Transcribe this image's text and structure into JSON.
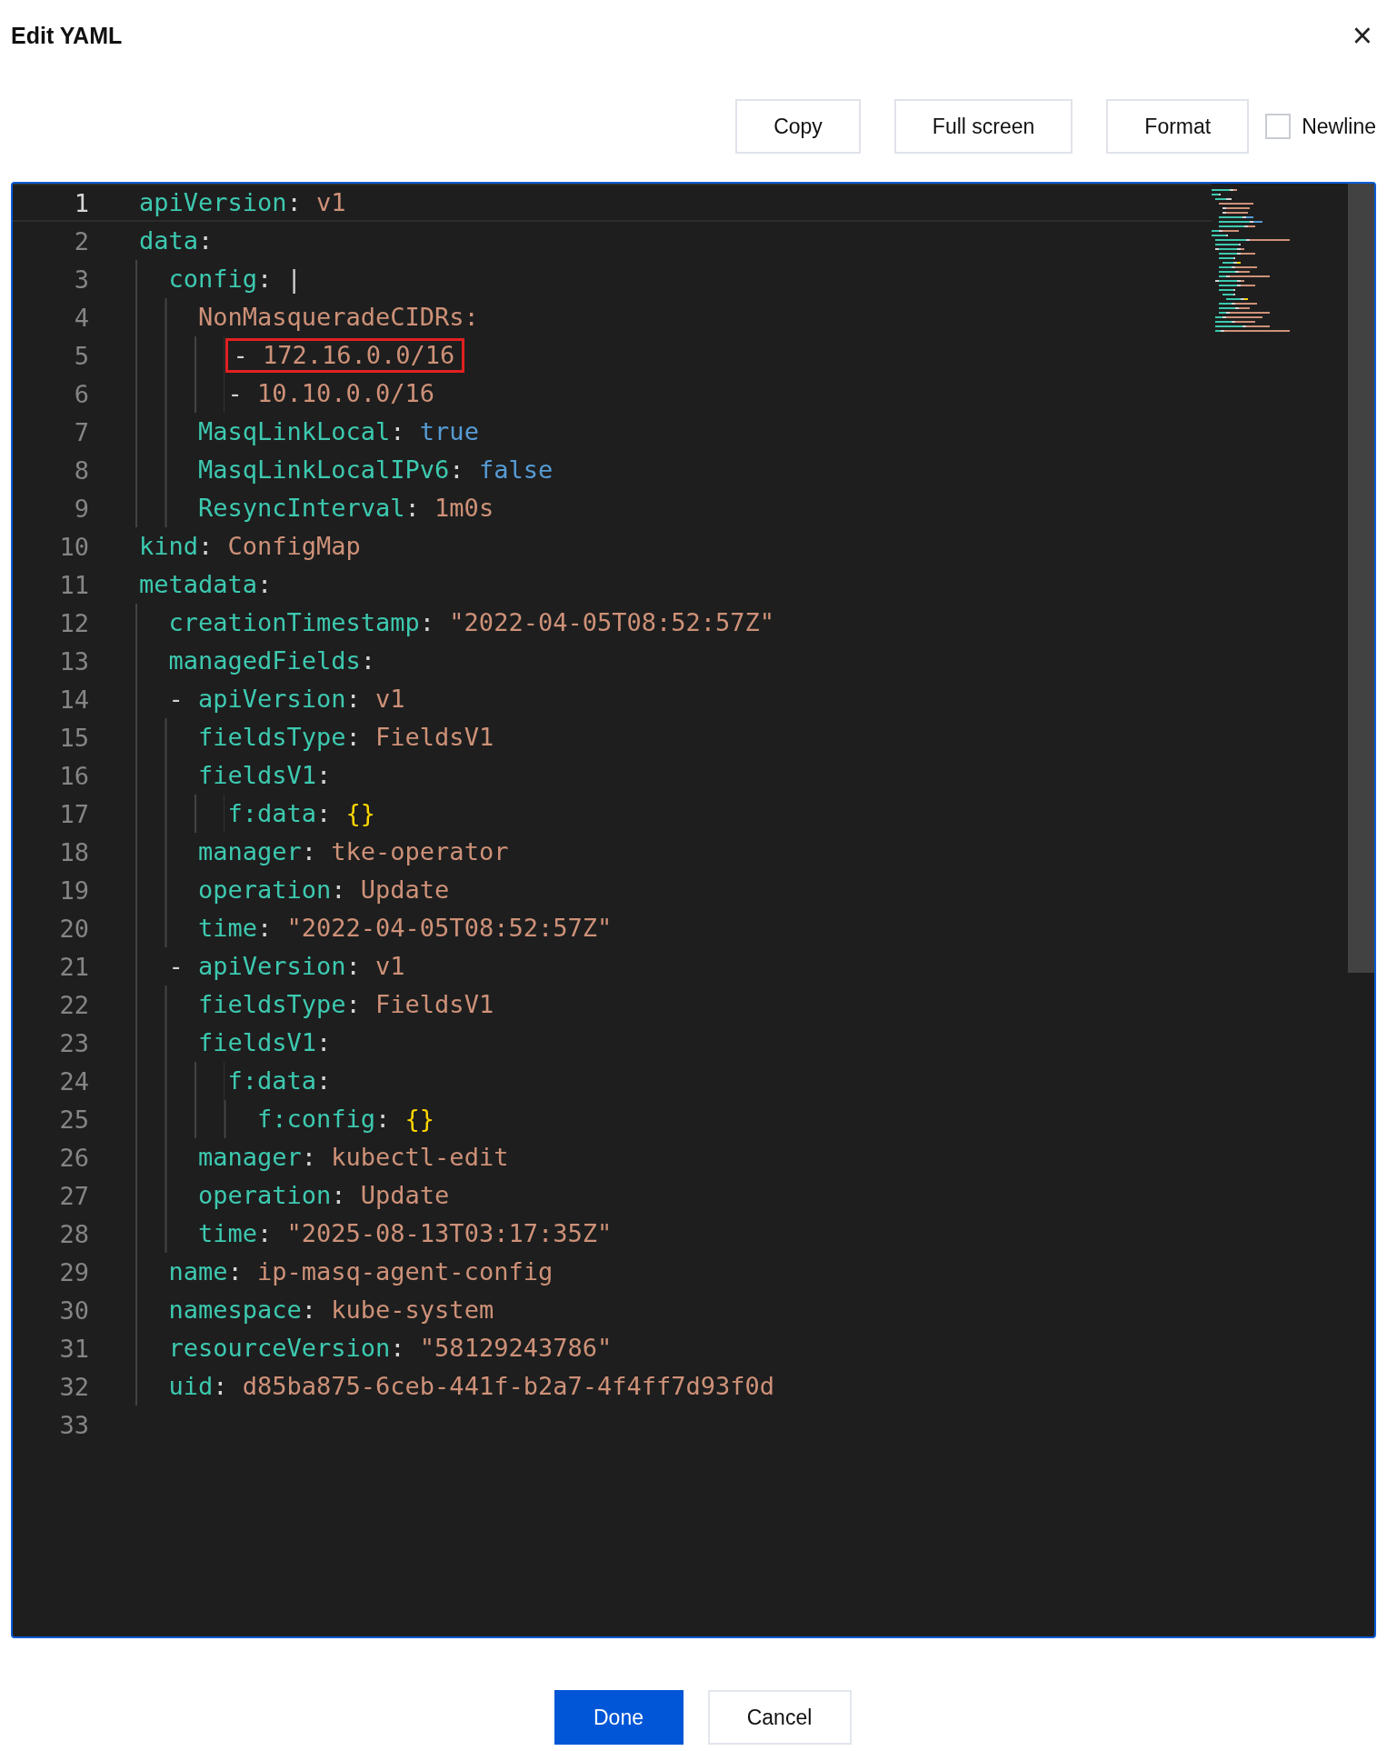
{
  "dialog": {
    "title": "Edit YAML",
    "close": "×"
  },
  "toolbar": {
    "buttons": [
      "Copy",
      "Full screen",
      "Format"
    ],
    "newline": {
      "label": "Newline",
      "checked": false
    }
  },
  "editor": {
    "lines": [
      {
        "number": "1",
        "current": true,
        "boxed": false,
        "tokens": [
          {
            "kind": "key",
            "text": "apiVersion"
          },
          {
            "kind": "punct",
            "text": ": "
          },
          {
            "kind": "value",
            "text": "v1"
          }
        ]
      },
      {
        "number": "2",
        "current": false,
        "boxed": false,
        "tokens": [
          {
            "kind": "key",
            "text": "data"
          },
          {
            "kind": "punct",
            "text": ":"
          }
        ],
        "children": [
          {
            "number": "3",
            "current": false,
            "boxed": false,
            "tokens": [
              {
                "kind": "key",
                "text": "config"
              },
              {
                "kind": "punct",
                "text": ": |"
              }
            ],
            "children": [
              {
                "number": "4",
                "current": false,
                "boxed": false,
                "tokens": [
                  {
                    "kind": "value",
                    "text": "NonMasqueradeCIDRs:"
                  }
                ],
                "children": [
                  {
                    "number": "5",
                    "current": false,
                    "boxed": true,
                    "tokens": [
                      {
                        "kind": "punct",
                        "text": "- "
                      },
                      {
                        "kind": "value",
                        "text": "172.16.0.0/16"
                      }
                    ]
                  },
                  {
                    "number": "6",
                    "current": false,
                    "boxed": false,
                    "tokens": [
                      {
                        "kind": "punct",
                        "text": "- "
                      },
                      {
                        "kind": "value",
                        "text": "10.10.0.0/16"
                      }
                    ]
                  }
                ]
              },
              {
                "number": "7",
                "current": false,
                "boxed": false,
                "tokens": [
                  {
                    "kind": "key",
                    "text": "MasqLinkLocal"
                  },
                  {
                    "kind": "punct",
                    "text": ": "
                  },
                  {
                    "kind": "bool",
                    "text": "true"
                  }
                ]
              },
              {
                "number": "8",
                "current": false,
                "boxed": false,
                "tokens": [
                  {
                    "kind": "key",
                    "text": "MasqLinkLocalIPv6"
                  },
                  {
                    "kind": "punct",
                    "text": ": "
                  },
                  {
                    "kind": "bool",
                    "text": "false"
                  }
                ]
              },
              {
                "number": "9",
                "current": false,
                "boxed": false,
                "tokens": [
                  {
                    "kind": "key",
                    "text": "ResyncInterval"
                  },
                  {
                    "kind": "punct",
                    "text": ": "
                  },
                  {
                    "kind": "value",
                    "text": "1m0s"
                  }
                ]
              }
            ]
          }
        ]
      },
      {
        "number": "10",
        "current": false,
        "boxed": false,
        "tokens": [
          {
            "kind": "key",
            "text": "kind"
          },
          {
            "kind": "punct",
            "text": ": "
          },
          {
            "kind": "value",
            "text": "ConfigMap"
          }
        ]
      },
      {
        "number": "11",
        "current": false,
        "boxed": false,
        "tokens": [
          {
            "kind": "key",
            "text": "metadata"
          },
          {
            "kind": "punct",
            "text": ":"
          }
        ],
        "children": [
          {
            "number": "12",
            "current": false,
            "boxed": false,
            "tokens": [
              {
                "kind": "key",
                "text": "creationTimestamp"
              },
              {
                "kind": "punct",
                "text": ": "
              },
              {
                "kind": "value",
                "text": "\"2022-04-05T08:52:57Z\""
              }
            ]
          },
          {
            "number": "13",
            "current": false,
            "boxed": false,
            "tokens": [
              {
                "kind": "key",
                "text": "managedFields"
              },
              {
                "kind": "punct",
                "text": ":"
              }
            ]
          },
          {
            "number": "14",
            "current": false,
            "boxed": false,
            "tokens": [
              {
                "kind": "punct",
                "text": "- "
              },
              {
                "kind": "key",
                "text": "apiVersion"
              },
              {
                "kind": "punct",
                "text": ": "
              },
              {
                "kind": "value",
                "text": "v1"
              }
            ],
            "children": [
              {
                "number": "15",
                "current": false,
                "boxed": false,
                "tokens": [
                  {
                    "kind": "key",
                    "text": "fieldsType"
                  },
                  {
                    "kind": "punct",
                    "text": ": "
                  },
                  {
                    "kind": "value",
                    "text": "FieldsV1"
                  }
                ]
              },
              {
                "number": "16",
                "current": false,
                "boxed": false,
                "tokens": [
                  {
                    "kind": "key",
                    "text": "fieldsV1"
                  },
                  {
                    "kind": "punct",
                    "text": ":"
                  }
                ],
                "children": [
                  {
                    "number": "17",
                    "current": false,
                    "boxed": false,
                    "tokens": [
                      {
                        "kind": "key",
                        "text": "f:data"
                      },
                      {
                        "kind": "punct",
                        "text": ": "
                      },
                      {
                        "kind": "brace",
                        "text": "{}"
                      }
                    ]
                  }
                ]
              },
              {
                "number": "18",
                "current": false,
                "boxed": false,
                "tokens": [
                  {
                    "kind": "key",
                    "text": "manager"
                  },
                  {
                    "kind": "punct",
                    "text": ": "
                  },
                  {
                    "kind": "value",
                    "text": "tke-operator"
                  }
                ]
              },
              {
                "number": "19",
                "current": false,
                "boxed": false,
                "tokens": [
                  {
                    "kind": "key",
                    "text": "operation"
                  },
                  {
                    "kind": "punct",
                    "text": ": "
                  },
                  {
                    "kind": "value",
                    "text": "Update"
                  }
                ]
              },
              {
                "number": "20",
                "current": false,
                "boxed": false,
                "tokens": [
                  {
                    "kind": "key",
                    "text": "time"
                  },
                  {
                    "kind": "punct",
                    "text": ": "
                  },
                  {
                    "kind": "value",
                    "text": "\"2022-04-05T08:52:57Z\""
                  }
                ]
              }
            ]
          },
          {
            "number": "21",
            "current": false,
            "boxed": false,
            "tokens": [
              {
                "kind": "punct",
                "text": "- "
              },
              {
                "kind": "key",
                "text": "apiVersion"
              },
              {
                "kind": "punct",
                "text": ": "
              },
              {
                "kind": "value",
                "text": "v1"
              }
            ],
            "children": [
              {
                "number": "22",
                "current": false,
                "boxed": false,
                "tokens": [
                  {
                    "kind": "key",
                    "text": "fieldsType"
                  },
                  {
                    "kind": "punct",
                    "text": ": "
                  },
                  {
                    "kind": "value",
                    "text": "FieldsV1"
                  }
                ]
              },
              {
                "number": "23",
                "current": false,
                "boxed": false,
                "tokens": [
                  {
                    "kind": "key",
                    "text": "fieldsV1"
                  },
                  {
                    "kind": "punct",
                    "text": ":"
                  }
                ],
                "children": [
                  {
                    "number": "24",
                    "current": false,
                    "boxed": false,
                    "tokens": [
                      {
                        "kind": "key",
                        "text": "f:data"
                      },
                      {
                        "kind": "punct",
                        "text": ":"
                      }
                    ],
                    "children": [
                      {
                        "number": "25",
                        "current": false,
                        "boxed": false,
                        "tokens": [
                          {
                            "kind": "key",
                            "text": "f:config"
                          },
                          {
                            "kind": "punct",
                            "text": ": "
                          },
                          {
                            "kind": "brace",
                            "text": "{}"
                          }
                        ]
                      }
                    ]
                  }
                ]
              },
              {
                "number": "26",
                "current": false,
                "boxed": false,
                "tokens": [
                  {
                    "kind": "key",
                    "text": "manager"
                  },
                  {
                    "kind": "punct",
                    "text": ": "
                  },
                  {
                    "kind": "value",
                    "text": "kubectl-edit"
                  }
                ]
              },
              {
                "number": "27",
                "current": false,
                "boxed": false,
                "tokens": [
                  {
                    "kind": "key",
                    "text": "operation"
                  },
                  {
                    "kind": "punct",
                    "text": ": "
                  },
                  {
                    "kind": "value",
                    "text": "Update"
                  }
                ]
              },
              {
                "number": "28",
                "current": false,
                "boxed": false,
                "tokens": [
                  {
                    "kind": "key",
                    "text": "time"
                  },
                  {
                    "kind": "punct",
                    "text": ": "
                  },
                  {
                    "kind": "value",
                    "text": "\"2025-08-13T03:17:35Z\""
                  }
                ]
              }
            ]
          },
          {
            "number": "29",
            "current": false,
            "boxed": false,
            "tokens": [
              {
                "kind": "key",
                "text": "name"
              },
              {
                "kind": "punct",
                "text": ": "
              },
              {
                "kind": "value",
                "text": "ip-masq-agent-config"
              }
            ]
          },
          {
            "number": "30",
            "current": false,
            "boxed": false,
            "tokens": [
              {
                "kind": "key",
                "text": "namespace"
              },
              {
                "kind": "punct",
                "text": ": "
              },
              {
                "kind": "value",
                "text": "kube-system"
              }
            ]
          },
          {
            "number": "31",
            "current": false,
            "boxed": false,
            "tokens": [
              {
                "kind": "key",
                "text": "resourceVersion"
              },
              {
                "kind": "punct",
                "text": ": "
              },
              {
                "kind": "value",
                "text": "\"58129243786\""
              }
            ]
          },
          {
            "number": "32",
            "current": false,
            "boxed": false,
            "tokens": [
              {
                "kind": "key",
                "text": "uid"
              },
              {
                "kind": "punct",
                "text": ": "
              },
              {
                "kind": "value",
                "text": "d85ba875-6ceb-441f-b2a7-4f4ff7d93f0d"
              }
            ]
          }
        ]
      },
      {
        "number": "33",
        "current": false,
        "boxed": false
      }
    ]
  },
  "footer": {
    "buttons": [
      {
        "label": "Done",
        "kind": "primary"
      },
      {
        "label": "Cancel",
        "kind": "secondary"
      }
    ]
  }
}
